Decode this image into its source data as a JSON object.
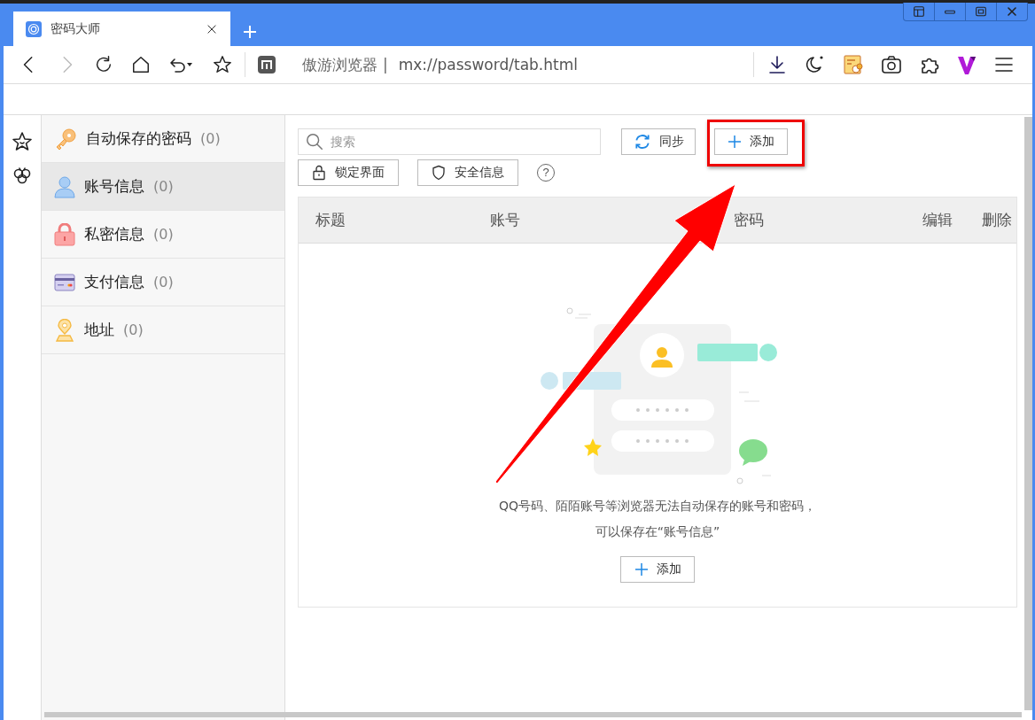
{
  "tabs": [
    {
      "title": "密码大师",
      "selected": true
    }
  ],
  "address_bar": {
    "site_name": "傲游浏览器",
    "separator": "|",
    "url": "mx://password/tab.html"
  },
  "sidebar": {
    "items": [
      {
        "kind": "key",
        "label": "自动保存的密码",
        "count": "(0)",
        "selected": false
      },
      {
        "kind": "person",
        "label": "账号信息",
        "count": "(0)",
        "selected": true
      },
      {
        "kind": "lock",
        "label": "私密信息",
        "count": "(0)",
        "selected": false
      },
      {
        "kind": "card",
        "label": "支付信息",
        "count": "(0)",
        "selected": false
      },
      {
        "kind": "pin",
        "label": "地址",
        "count": "(0)",
        "selected": false
      }
    ]
  },
  "toolbar": {
    "search_placeholder": "搜索",
    "sync": "同步",
    "add": "添加",
    "lock": "锁定界面",
    "security": "安全信息",
    "help": "?"
  },
  "table": {
    "columns": [
      "标题",
      "账号",
      "密码",
      "编辑",
      "删除"
    ]
  },
  "empty_state": {
    "message": "QQ号码、陌陌账号等浏览器无法自动保存的账号和密码，",
    "message_2": "可以保存在“账号信息”",
    "button": "添加"
  }
}
